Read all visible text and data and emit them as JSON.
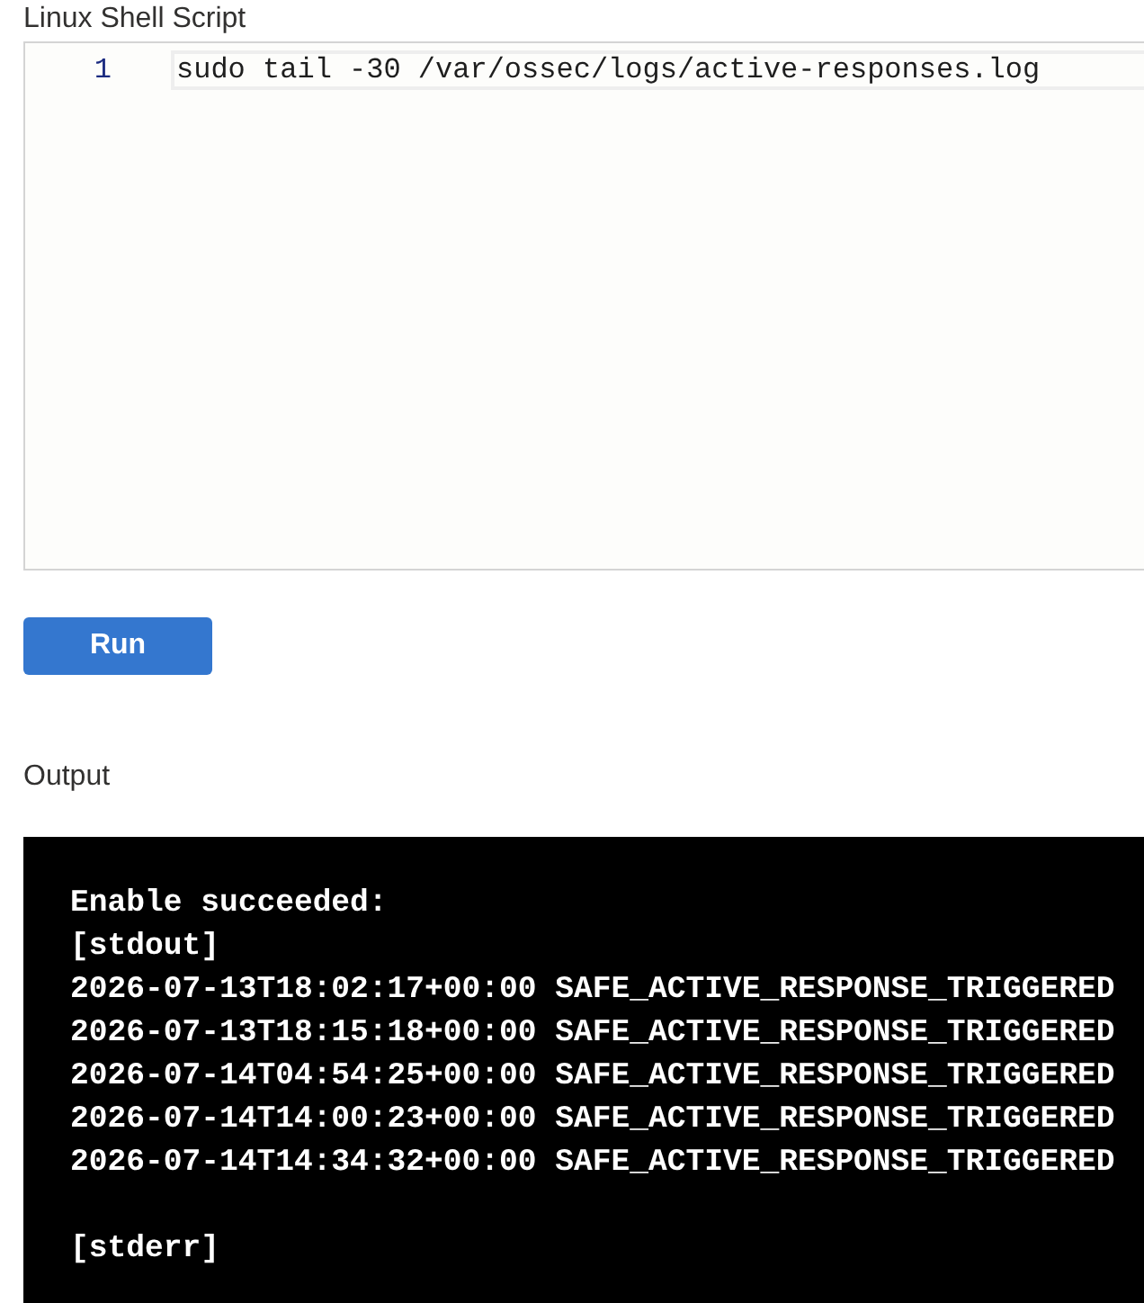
{
  "script_editor": {
    "label": "Linux Shell Script",
    "lines": [
      {
        "number": "1",
        "code": "sudo tail -30 /var/ossec/logs/active-responses.log",
        "current": true
      }
    ]
  },
  "run_button": {
    "label": "Run"
  },
  "output": {
    "label": "Output",
    "status": "Enable succeeded:",
    "streams": [
      {
        "header": "[stdout]",
        "lines": [
          "2026-07-13T18:02:17+00:00 SAFE_ACTIVE_RESPONSE_TRIGGERED",
          "2026-07-13T18:15:18+00:00 SAFE_ACTIVE_RESPONSE_TRIGGERED",
          "2026-07-14T04:54:25+00:00 SAFE_ACTIVE_RESPONSE_TRIGGERED",
          "2026-07-14T14:00:23+00:00 SAFE_ACTIVE_RESPONSE_TRIGGERED",
          "2026-07-14T14:34:32+00:00 SAFE_ACTIVE_RESPONSE_TRIGGERED"
        ]
      },
      {
        "header": "[stderr]"
      }
    ]
  }
}
